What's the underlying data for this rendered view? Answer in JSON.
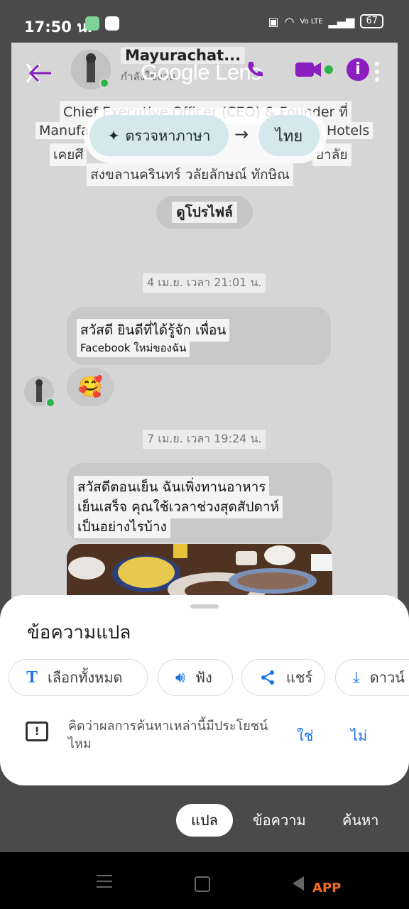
{
  "status_bar": {
    "time": "17:50 น.",
    "battery": "67",
    "net_label": "Vo LTE"
  },
  "header": {
    "contact_name": "Mayurachat...",
    "contact_status": "กำลังใช้งาน",
    "lens_title": "Google Lens"
  },
  "profile_overlay": {
    "line1": "Chief Executive Officer (CEO) & Founder ที่",
    "line2_left": "Manufa",
    "line2_right": "Hotels",
    "line3_left": "เคยศึ",
    "line3_right": "ยาลัย",
    "line4": "สงขลานครินทร์ วลัยลักษณ์ ทักษิณ"
  },
  "language": {
    "detect_label": "ตรวจหาภาษา",
    "target_label": "ไทย"
  },
  "view_profile_label": "ดูโปรไฟล์",
  "messages": {
    "date1": "4 เม.ย. เวลา 21:01 น.",
    "msg1_line1": "สวัสดี ยินดีที่ได้รู้จัก เพื่อน",
    "msg1_line2": "Facebook ใหม่ของฉัน",
    "emoji": "🥰",
    "date2": "7 เม.ย. เวลา 19:24 น.",
    "msg2_line1": "สวัสดีตอนเย็น ฉันเพิ่งทานอาหาร",
    "msg2_line2": "เย็นเสร็จ คุณใช้เวลาช่วงสุดสัปดาห์",
    "msg2_line3": "เป็นอย่างไรบ้าง"
  },
  "sheet": {
    "title": "ข้อความแปล",
    "actions": [
      {
        "label": "เลือกทั้งหมด",
        "icon": "text-icon"
      },
      {
        "label": "ฟัง",
        "icon": "speaker-icon"
      },
      {
        "label": "แชร์",
        "icon": "share-icon"
      },
      {
        "label": "ดาวน์",
        "icon": "download-icon"
      }
    ],
    "feedback_question": "คิดว่าผลการค้นหาเหล่านี้มีประโยชน์ไหม",
    "yes": "ใช่",
    "no": "ไม่"
  },
  "tabs": {
    "translate": "แปล",
    "text": "ข้อความ",
    "search": "ค้นหา"
  },
  "watermark": "APP"
}
